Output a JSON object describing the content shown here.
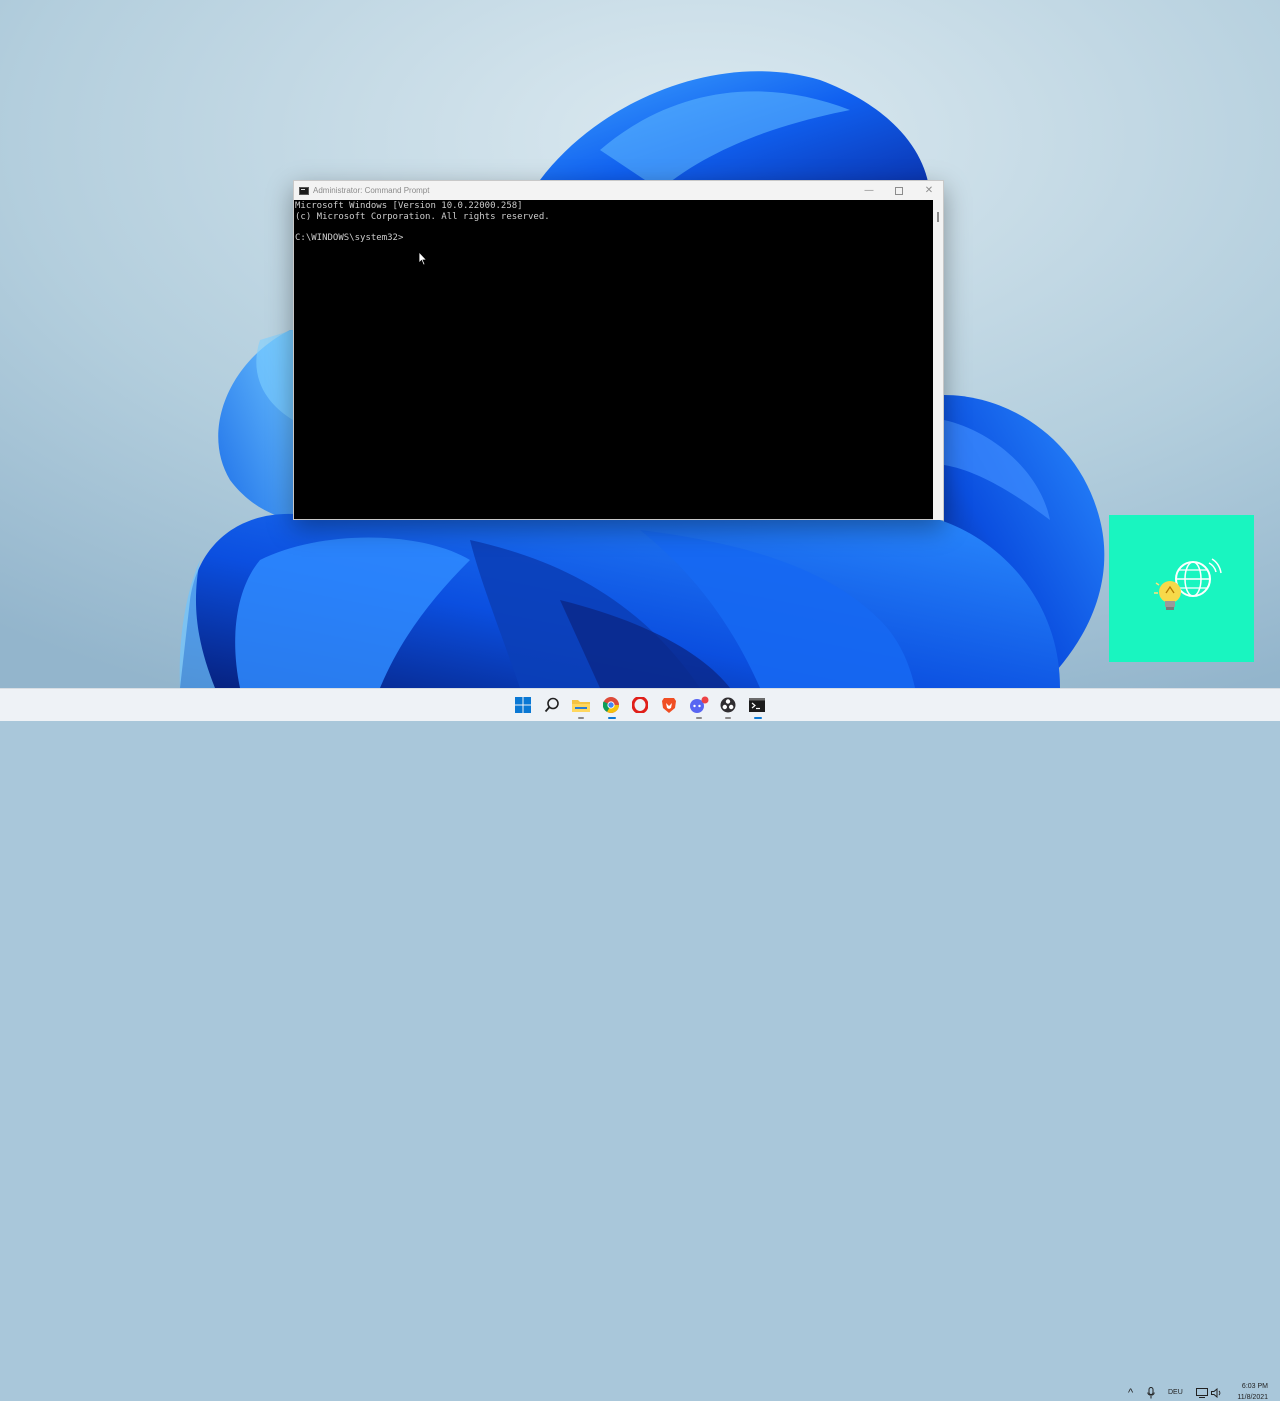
{
  "window": {
    "title": "Administrator: Command Prompt",
    "minimize_glyph": "—",
    "close_glyph": "✕",
    "console_lines": [
      "Microsoft Windows [Version 10.0.22000.258]",
      "(c) Microsoft Corporation. All rights reserved.",
      "",
      "C:\\WINDOWS\\system32>"
    ]
  },
  "taskbar": {
    "icons": [
      {
        "name": "start-icon",
        "color": "#0a78d4"
      },
      {
        "name": "search-icon",
        "color": "#222222"
      },
      {
        "name": "file-explorer-icon",
        "color": "#f5c343"
      },
      {
        "name": "chrome-icon",
        "color": "#dd4b39"
      },
      {
        "name": "opera-icon",
        "color": "#e0201a"
      },
      {
        "name": "brave-icon",
        "color": "#f04e23"
      },
      {
        "name": "discord-icon",
        "color": "#5865f2"
      },
      {
        "name": "obs-icon",
        "color": "#302e31"
      },
      {
        "name": "command-prompt-icon",
        "color": "#1c1c1c"
      }
    ],
    "tray": {
      "chevron_glyph": "^",
      "language": "DEU",
      "time": "6:03 PM",
      "date": "11/8/2021"
    }
  },
  "colors": {
    "accent": "#0a78d4",
    "widget": "#19f5c0",
    "console_bg": "#000000",
    "console_text": "#cccccc"
  }
}
